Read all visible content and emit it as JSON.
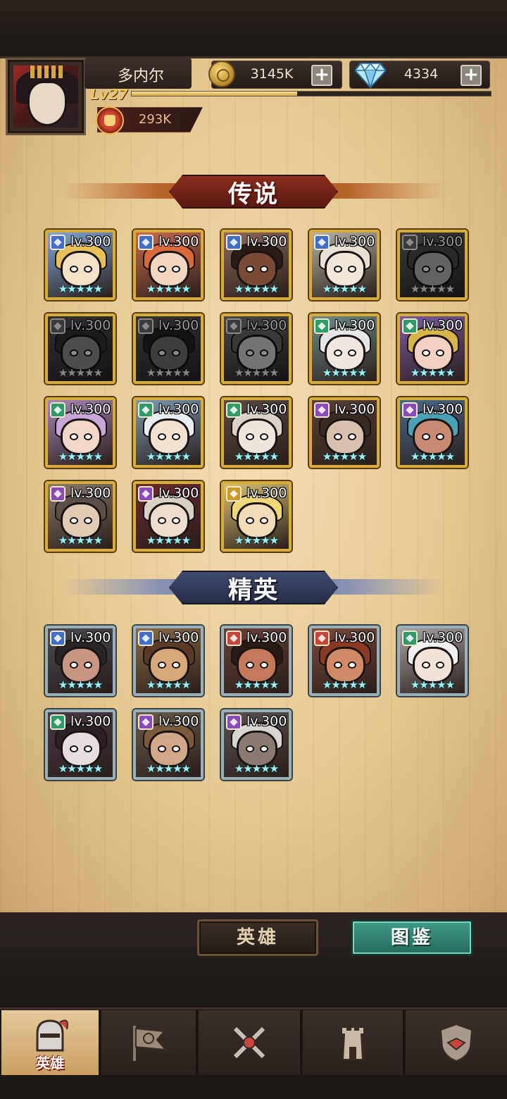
{
  "player": {
    "name": "多内尔",
    "level": "Lv27",
    "xp_fraction": 0.46,
    "power": "293K"
  },
  "resources": {
    "gold": "3145K",
    "gems": "4334",
    "plus_symbol": "+"
  },
  "sections": {
    "legend_title": "传说",
    "elite_title": "精英"
  },
  "legend_heroes": [
    {
      "level": "lv.300",
      "stars": "★★★★★",
      "class_color": "#3f6fc8",
      "locked": false,
      "bg": "#7fa7d6",
      "skin": "#f3e1c8",
      "hair": "#e7c05a"
    },
    {
      "level": "lv.300",
      "stars": "★★★★★",
      "class_color": "#3f6fc8",
      "locked": false,
      "bg": "#c86a4f",
      "skin": "#f3d6c0",
      "hair": "#d9683a"
    },
    {
      "level": "lv.300",
      "stars": "★★★★★",
      "class_color": "#3f6fc8",
      "locked": false,
      "bg": "#8b6a5a",
      "skin": "#7a4a36",
      "hair": "#2a1c16"
    },
    {
      "level": "lv.300",
      "stars": "★★★★★",
      "class_color": "#3f6fc8",
      "locked": false,
      "bg": "#b6b2a8",
      "skin": "#f2e6d8",
      "hair": "#e8e0d2"
    },
    {
      "level": "lv.300",
      "stars": "★★★★★",
      "class_color": "#c8453a",
      "locked": true,
      "bg": "#7a6a5a",
      "skin": "#bfb0a0",
      "hair": "#5a4a40"
    },
    {
      "level": "lv.300",
      "stars": "★★★★★",
      "class_color": "#c8453a",
      "locked": true,
      "bg": "#6a5a4a",
      "skin": "#a08a74",
      "hair": "#3a3028"
    },
    {
      "level": "lv.300",
      "stars": "★★★★★",
      "class_color": "#c8453a",
      "locked": true,
      "bg": "#7a5a4a",
      "skin": "#8a6a56",
      "hair": "#2a2220"
    },
    {
      "level": "lv.300",
      "stars": "★★★★★",
      "class_color": "#c8453a",
      "locked": true,
      "bg": "#8a847a",
      "skin": "#d6d2c8",
      "hair": "#6a6860"
    },
    {
      "level": "lv.300",
      "stars": "★★★★★",
      "class_color": "#2f9b6a",
      "locked": false,
      "bg": "#6f8c8a",
      "skin": "#f0e8e0",
      "hair": "#e6e6ea"
    },
    {
      "level": "lv.300",
      "stars": "★★★★★",
      "class_color": "#2f9b6a",
      "locked": false,
      "bg": "#7c5aa4",
      "skin": "#f1d1c1",
      "hair": "#d8b54a"
    },
    {
      "level": "lv.300",
      "stars": "★★★★★",
      "class_color": "#2f9b6a",
      "locked": false,
      "bg": "#a686b8",
      "skin": "#f2d6c8",
      "hair": "#c8a6d6"
    },
    {
      "level": "lv.300",
      "stars": "★★★★★",
      "class_color": "#2f9b6a",
      "locked": false,
      "bg": "#7a9ab4",
      "skin": "#f4e2d2",
      "hair": "#e8eef4"
    },
    {
      "level": "lv.300",
      "stars": "★★★★★",
      "class_color": "#2f9b6a",
      "locked": false,
      "bg": "#5a4a44",
      "skin": "#ede6dc",
      "hair": "#d8d2c8"
    },
    {
      "level": "lv.300",
      "stars": "★★★★★",
      "class_color": "#8a4ab8",
      "locked": false,
      "bg": "#5a4038",
      "skin": "#d8c2ae",
      "hair": "#3a2a24"
    },
    {
      "level": "lv.300",
      "stars": "★★★★★",
      "class_color": "#8a4ab8",
      "locked": false,
      "bg": "#4a6a8a",
      "skin": "#c88a70",
      "hair": "#4aa0b4"
    },
    {
      "level": "lv.300",
      "stars": "★★★★★",
      "class_color": "#8a4ab8",
      "locked": false,
      "bg": "#8a7a6a",
      "skin": "#e2cbb4",
      "hair": "#5a5048"
    },
    {
      "level": "lv.300",
      "stars": "★★★★★",
      "class_color": "#8a4ab8",
      "locked": false,
      "bg": "#6a2a2a",
      "skin": "#ecdccc",
      "hair": "#d8d0c4"
    },
    {
      "level": "lv.300",
      "stars": "★★★★★",
      "class_color": "#c89a2a",
      "locked": false,
      "bg": "#d8c070",
      "skin": "#f2dcb8",
      "hair": "#f0d878"
    }
  ],
  "elite_heroes": [
    {
      "level": "lv.300",
      "stars": "★★★★★",
      "class_color": "#3f6fc8",
      "locked": false,
      "bg": "#4a4a52",
      "skin": "#c89680",
      "hair": "#2a2428"
    },
    {
      "level": "lv.300",
      "stars": "★★★★★",
      "class_color": "#3f6fc8",
      "locked": false,
      "bg": "#8a6a48",
      "skin": "#d8a878",
      "hair": "#5a3a24"
    },
    {
      "level": "lv.300",
      "stars": "★★★★★",
      "class_color": "#c8453a",
      "locked": false,
      "bg": "#6a4038",
      "skin": "#c47a5a",
      "hair": "#2a1a16"
    },
    {
      "level": "lv.300",
      "stars": "★★★★★",
      "class_color": "#c8453a",
      "locked": false,
      "bg": "#7a4a3a",
      "skin": "#d08a66",
      "hair": "#8a3a22"
    },
    {
      "level": "lv.300",
      "stars": "★★★★★",
      "class_color": "#2f9b6a",
      "locked": false,
      "bg": "#a8a4a4",
      "skin": "#f2e2d8",
      "hair": "#f0f0f0"
    },
    {
      "level": "lv.300",
      "stars": "★★★★★",
      "class_color": "#2f9b6a",
      "locked": false,
      "bg": "#4a3a44",
      "skin": "#e6dede",
      "hair": "#2a2228"
    },
    {
      "level": "lv.300",
      "stars": "★★★★★",
      "class_color": "#8a4ab8",
      "locked": false,
      "bg": "#6a5a4a",
      "skin": "#d0a888",
      "hair": "#7a5a3a"
    },
    {
      "level": "lv.300",
      "stars": "★★★★★",
      "class_color": "#8a4ab8",
      "locked": false,
      "bg": "#5a5250",
      "skin": "#8a7a72",
      "hair": "#d8d4d0"
    }
  ],
  "tabs": {
    "heroes_label": "英雄",
    "codex_label": "图鉴"
  },
  "nav": {
    "heroes_label": "英雄"
  }
}
